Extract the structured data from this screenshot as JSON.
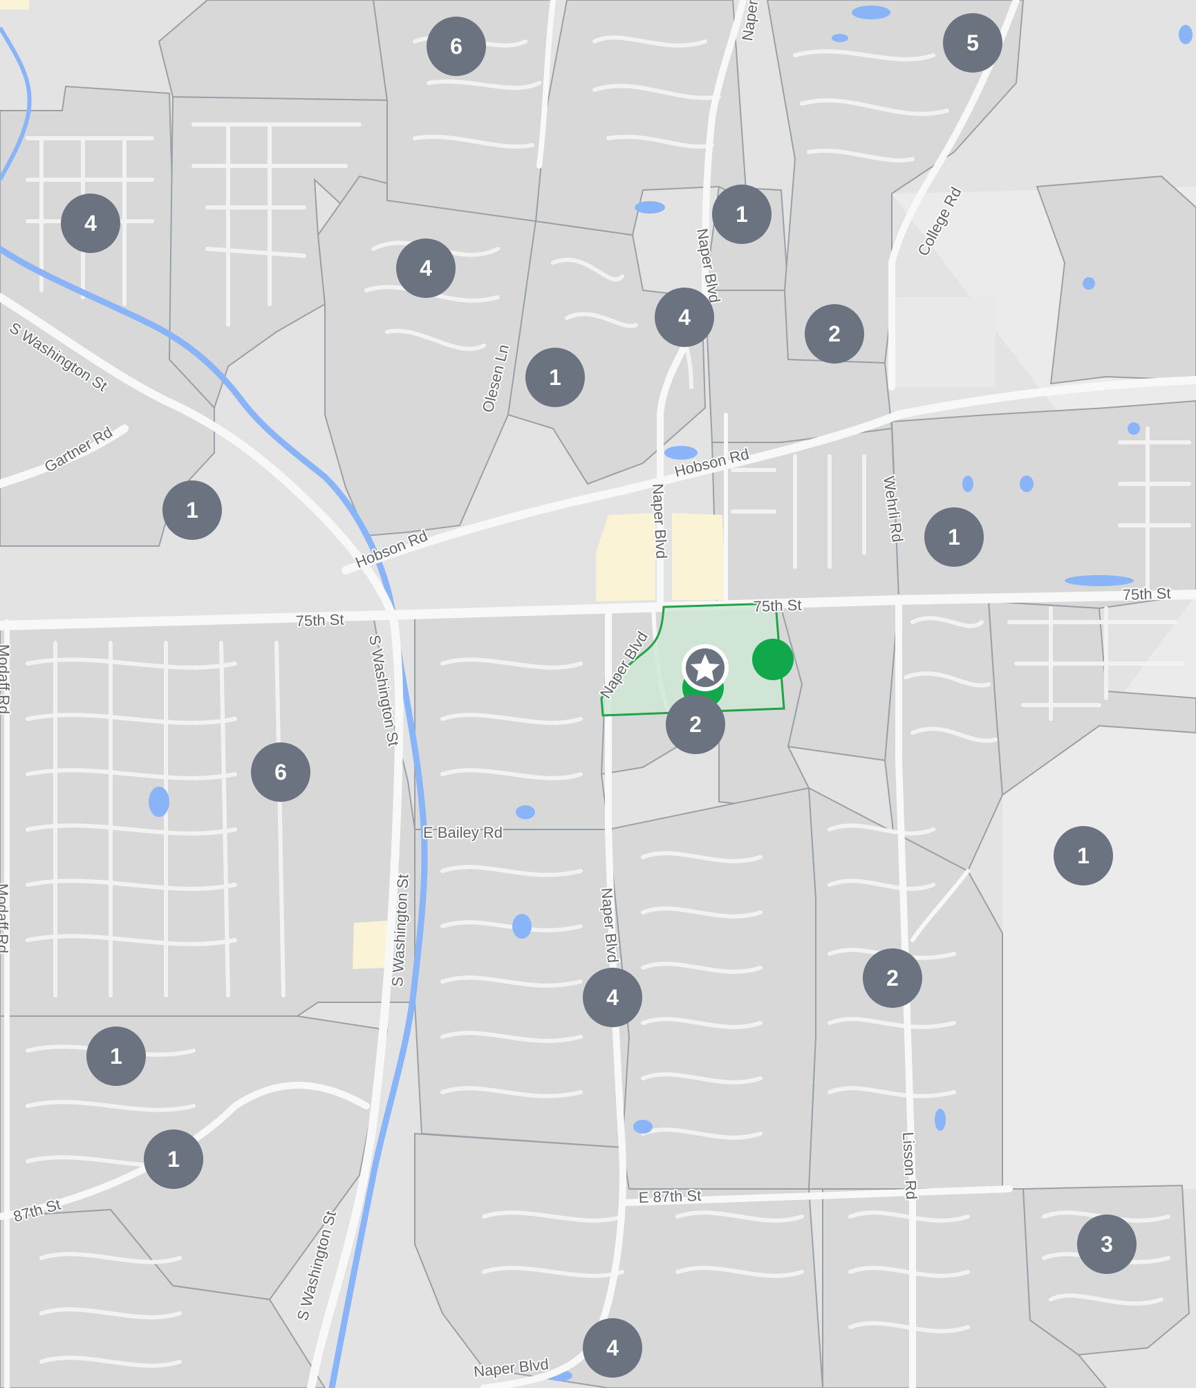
{
  "colors": {
    "map_background": "#e3e3e3",
    "block_fill": "#d8d8d8",
    "block_stroke": "#9aa0a6",
    "road": "#f7f7f7",
    "minor_road": "#ededed",
    "water": "#8ab4f8",
    "school_zone": "#fbf3d5",
    "cluster_fill": "#6b7280",
    "selected_area_fill": "#cfe8d6",
    "selected_area_stroke": "#1ea446",
    "pin_green": "#10a84a"
  },
  "streets": {
    "naper_blvd_north": "Naper",
    "naper_blvd_upper": "Naper Blvd",
    "naper_blvd_center": "Naper Blvd",
    "naper_blvd_curve": "Naper Blvd",
    "naper_blvd_south": "Naper Blvd",
    "naper_blvd_bottom": "Naper Blvd",
    "college_rd": "College Rd",
    "s_washington_nw": "S Washington St",
    "s_washington_mid": "S Washington St",
    "s_washington_south": "S Washington St",
    "s_washington_bottom": "S Washington St",
    "gartner_rd": "Gartner Rd",
    "olesen_ln": "Olesen Ln",
    "hobson_rd_east": "Hobson Rd",
    "hobson_rd_west": "Hobson Rd",
    "wehrli_rd": "Wehrli Rd",
    "75th_st_west": "75th St",
    "75th_st_center": "75th St",
    "75th_st_east": "75th St",
    "modaff_rd_upper": "Modaff Rd",
    "modaff_rd_lower": "Modaff Rd",
    "e_bailey_rd": "E Bailey Rd",
    "e_87th_st": "E 87th St",
    "87th_st": "87th St",
    "lisson_rd": "Lisson Rd"
  },
  "clusters": [
    {
      "id": "c1",
      "count": "6"
    },
    {
      "id": "c2",
      "count": "5"
    },
    {
      "id": "c3",
      "count": "4"
    },
    {
      "id": "c4",
      "count": "4"
    },
    {
      "id": "c5",
      "count": "1"
    },
    {
      "id": "c6",
      "count": "4"
    },
    {
      "id": "c7",
      "count": "2"
    },
    {
      "id": "c8",
      "count": "1"
    },
    {
      "id": "c9",
      "count": "1"
    },
    {
      "id": "c10",
      "count": "1"
    },
    {
      "id": "c11",
      "count": "2"
    },
    {
      "id": "c12",
      "count": "6"
    },
    {
      "id": "c13",
      "count": "1"
    },
    {
      "id": "c14",
      "count": "2"
    },
    {
      "id": "c15",
      "count": "4"
    },
    {
      "id": "c16",
      "count": "1"
    },
    {
      "id": "c17",
      "count": "1"
    },
    {
      "id": "c18",
      "count": "3"
    },
    {
      "id": "c19",
      "count": "4"
    }
  ],
  "selected_home_icon": "star-icon"
}
